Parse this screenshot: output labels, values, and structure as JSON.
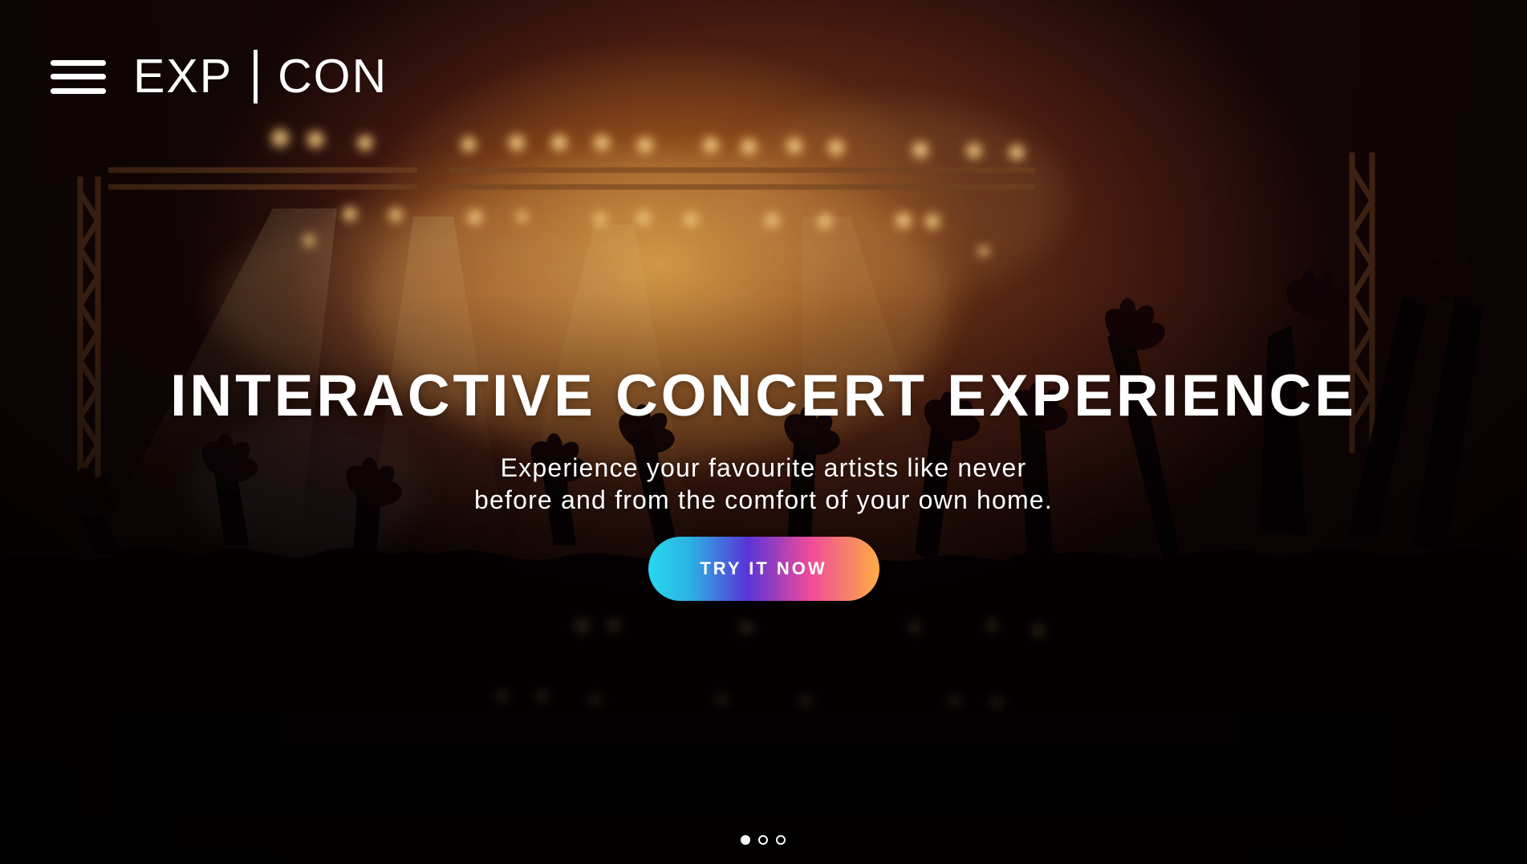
{
  "brand": {
    "left": "EXP",
    "right": "CON"
  },
  "hero": {
    "title": "INTERACTIVE CONCERT EXPERIENCE",
    "subtitle_line_1": "Experience your favourite artists like never",
    "subtitle_line_2": "before and from the comfort of your own home.",
    "cta_label": "TRY IT NOW",
    "background": "concert crowd with stage lights"
  },
  "navigation": {
    "menu_icon": "hamburger-menu-icon"
  },
  "pagination": {
    "active_slide": 1,
    "slide_count": 3
  },
  "colors": {
    "text": "#ffffff",
    "button_cyan": "#28d8ef",
    "button_purple": "#5a34d8",
    "button_pink": "#ef4b9a",
    "button_orange": "#ffad43"
  }
}
